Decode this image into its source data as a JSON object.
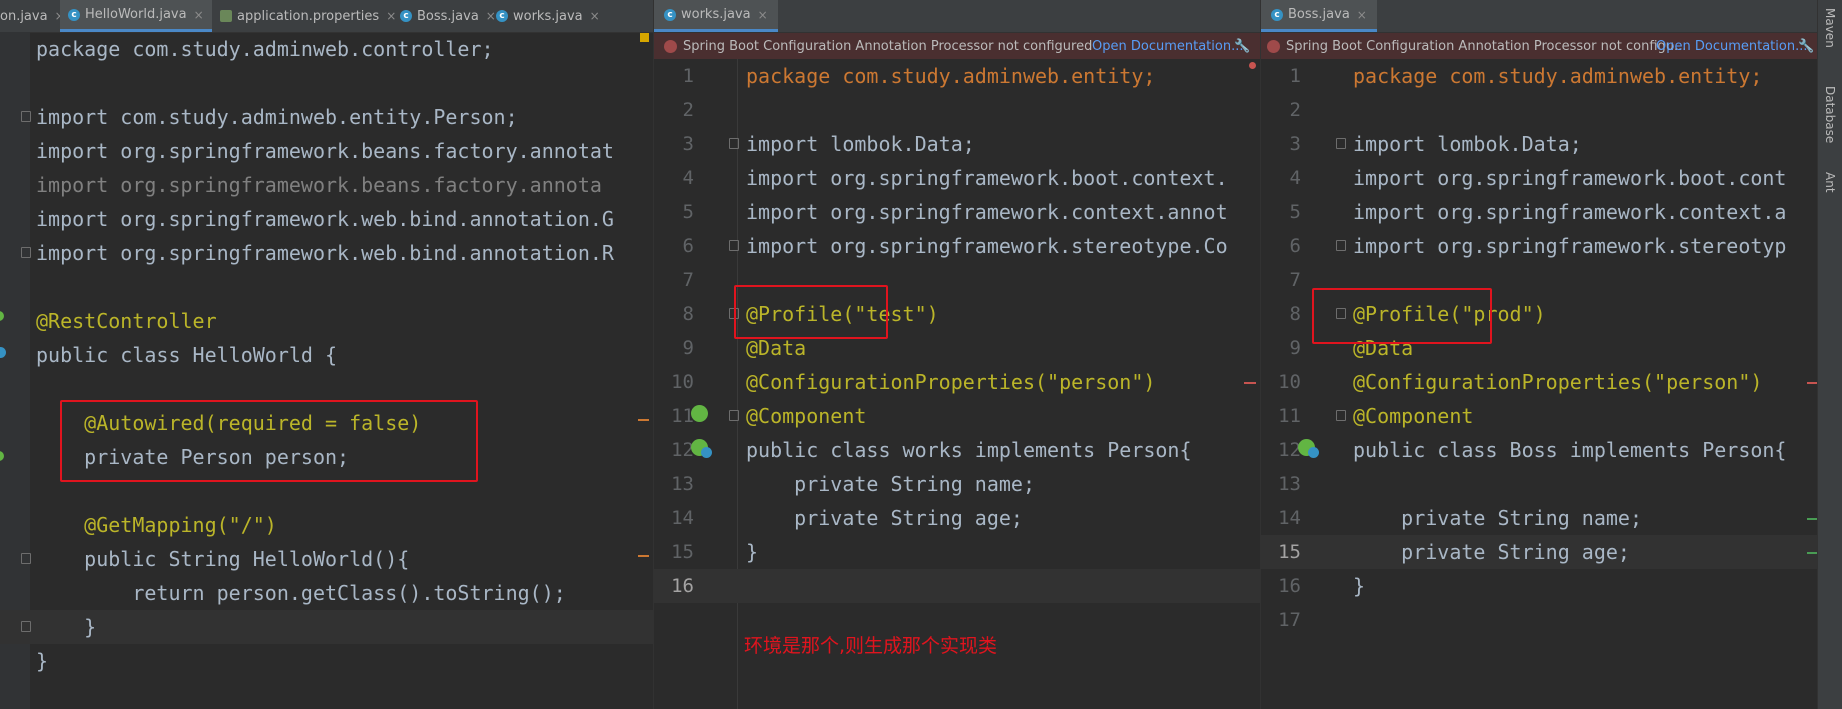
{
  "left_pane": {
    "tabs": [
      {
        "label": "on.java",
        "icon": "class-icon"
      },
      {
        "label": "HelloWorld.java",
        "icon": "class-icon",
        "active": true
      },
      {
        "label": "application.properties",
        "icon": "properties-icon"
      },
      {
        "label": "Boss.java",
        "icon": "class-icon"
      },
      {
        "label": "works.java",
        "icon": "class-icon"
      }
    ],
    "close_glyph": "×",
    "lines": [
      "package com.study.adminweb.controller;",
      "",
      "import com.study.adminweb.entity.Person;",
      "import org.springframework.beans.factory.annotat",
      "import org.springframework.beans.factory.annota",
      "import org.springframework.web.bind.annotation.G",
      "import org.springframework.web.bind.annotation.R",
      "",
      "@RestController",
      "public class HelloWorld {",
      "",
      "    @Autowired(required = false)",
      "    private Person person;",
      "",
      "    @GetMapping(\"/\")",
      "    public String HelloWorld(){",
      "        return person.getClass().toString();",
      "    }",
      "}"
    ]
  },
  "middle_pane": {
    "tab": {
      "label": "works.java",
      "icon": "class-icon"
    },
    "banner": {
      "message": "Spring Boot Configuration Annotation Processor not configured",
      "link": "Open Documentation..."
    },
    "line_numbers": [
      "1",
      "2",
      "3",
      "4",
      "5",
      "6",
      "7",
      "8",
      "9",
      "10",
      "11",
      "12",
      "13",
      "14",
      "15",
      "16"
    ],
    "lines": [
      "package com.study.adminweb.entity;",
      "",
      "import lombok.Data;",
      "import org.springframework.boot.context.",
      "import org.springframework.context.annot",
      "import org.springframework.stereotype.Co",
      "",
      "@Profile(\"test\")",
      "@Data",
      "@ConfigurationProperties(\"person\")",
      "@Component",
      "public class works implements Person{",
      "    private String name;",
      "    private String age;",
      "}",
      ""
    ],
    "annotation_note": "环境是那个,则生成那个实现类"
  },
  "right_pane": {
    "tab": {
      "label": "Boss.java",
      "icon": "class-icon"
    },
    "banner": {
      "message": "Spring Boot Configuration Annotation Processor not configu...",
      "link": "Open Documentation..."
    },
    "line_numbers": [
      "1",
      "2",
      "3",
      "4",
      "5",
      "6",
      "7",
      "8",
      "9",
      "10",
      "11",
      "12",
      "13",
      "14",
      "15",
      "16",
      "17"
    ],
    "lines": [
      "package com.study.adminweb.entity;",
      "",
      "import lombok.Data;",
      "import org.springframework.boot.cont",
      "import org.springframework.context.a",
      "import org.springframework.stereotyp",
      "",
      "@Profile(\"prod\")",
      "@Data",
      "@ConfigurationProperties(\"person\")",
      "@Component",
      "public class Boss implements Person{",
      "",
      "    private String name;",
      "    private String age;",
      "}",
      ""
    ]
  },
  "sidebar": {
    "items": [
      "Maven",
      "Database",
      "Ant"
    ]
  },
  "colors": {
    "keyword": "#cc7832",
    "annotation": "#bbb529",
    "string": "#6a8759",
    "field": "#9876aa",
    "text": "#a9b7c6",
    "red_box": "#e0141e"
  }
}
